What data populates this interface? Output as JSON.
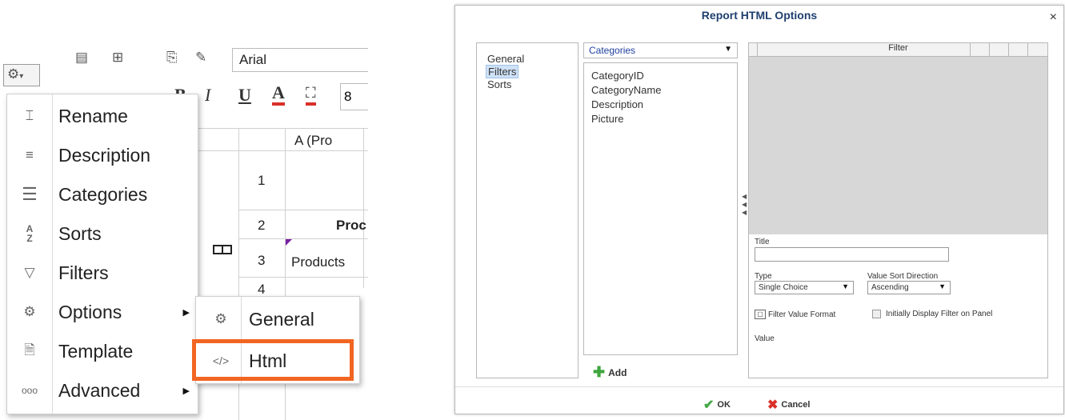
{
  "editor": {
    "font_name": "Arial",
    "font_size": "8",
    "gear_icon": "gear-icon",
    "bold_label": "B",
    "italic_label": "I",
    "underline_label": "U",
    "font_color_label": "A",
    "fill_icon": "paint-bucket-icon",
    "colors": {
      "font_color": "#d9302a",
      "fill_color": "#d9302a",
      "highlight": "#f26522"
    }
  },
  "sheet": {
    "column_header": "A (Pro",
    "row_numbers": [
      "1",
      "2",
      "3",
      "4"
    ],
    "cells": {
      "r2": "Proc",
      "r3": "Products"
    }
  },
  "context_menu": {
    "items": [
      {
        "label": "Rename",
        "icon": "rename-icon"
      },
      {
        "label": "Description",
        "icon": "description-icon"
      },
      {
        "label": "Categories",
        "icon": "categories-icon"
      },
      {
        "label": "Sorts",
        "icon": "sort-az-icon"
      },
      {
        "label": "Filters",
        "icon": "filter-icon"
      },
      {
        "label": "Options",
        "icon": "options-gear-icon",
        "has_submenu": true
      },
      {
        "label": "Template",
        "icon": "template-icon"
      },
      {
        "label": "Advanced",
        "icon": "ellipsis-icon",
        "has_submenu": true
      }
    ],
    "submenu": [
      {
        "label": "General",
        "icon": "gear-icon"
      },
      {
        "label": "Html",
        "icon": "code-icon",
        "highlighted": true
      }
    ]
  },
  "dialog": {
    "title": "Report HTML Options",
    "close": "×",
    "nav": [
      "General",
      "Filters",
      "Sorts"
    ],
    "nav_selected": "Filters",
    "category_select": "Categories",
    "fields": [
      "CategoryID",
      "CategoryName",
      "Description",
      "Picture"
    ],
    "add_label": "Add",
    "filter_header": "Filter",
    "title_label": "Title",
    "type_label": "Type",
    "type_value": "Single Choice",
    "sort_dir_label": "Value Sort Direction",
    "sort_dir_value": "Ascending",
    "filter_value_format": "Filter Value Format",
    "initially_display": "Initially Display Filter on Panel",
    "value_label": "Value",
    "ok_label": "OK",
    "cancel_label": "Cancel"
  }
}
